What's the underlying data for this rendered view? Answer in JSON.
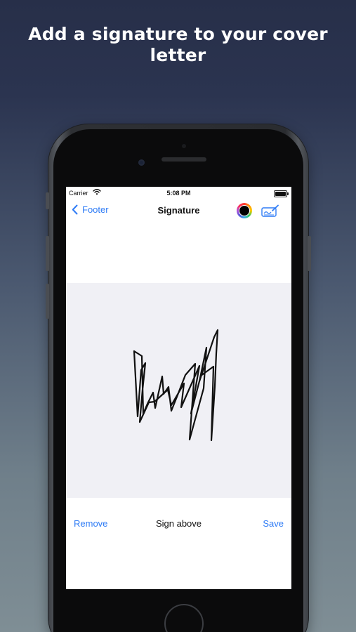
{
  "promo": {
    "title": "Add a signature to your cover letter"
  },
  "status_bar": {
    "carrier": "Carrier",
    "time": "5:08 PM"
  },
  "nav": {
    "back_label": "Footer",
    "title": "Signature",
    "selected_pen_color": "#000000"
  },
  "bottom_bar": {
    "remove_label": "Remove",
    "hint": "Sign above",
    "save_label": "Save"
  },
  "colors": {
    "accent": "#2f7cf6",
    "canvas_background": "#f0f0f5"
  },
  "icons": {
    "back": "chevron-left-icon",
    "color_picker": "color-wheel-icon",
    "signature_tool": "signature-pen-icon",
    "wifi": "wifi-icon",
    "battery": "battery-icon"
  }
}
